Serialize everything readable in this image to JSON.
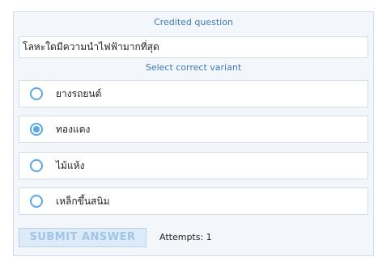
{
  "header": {
    "title": "Credited question"
  },
  "question": {
    "text": "โลหะใดมีความนำไฟฟ้ามากที่สุด"
  },
  "instruction": "Select correct variant",
  "options": [
    {
      "label": "ยางรถยนต์",
      "selected": false
    },
    {
      "label": "ทองแดง",
      "selected": true
    },
    {
      "label": "ไม้แห้ง",
      "selected": false
    },
    {
      "label": "เหล็กขึ้นสนิม",
      "selected": false
    }
  ],
  "footer": {
    "submit_label": "SUBMIT ANSWER",
    "attempts_text": "Attempts: 1"
  },
  "colors": {
    "accent": "#3b78b8",
    "radio": "#5aa8e8",
    "panel": "#f3f7fb"
  }
}
